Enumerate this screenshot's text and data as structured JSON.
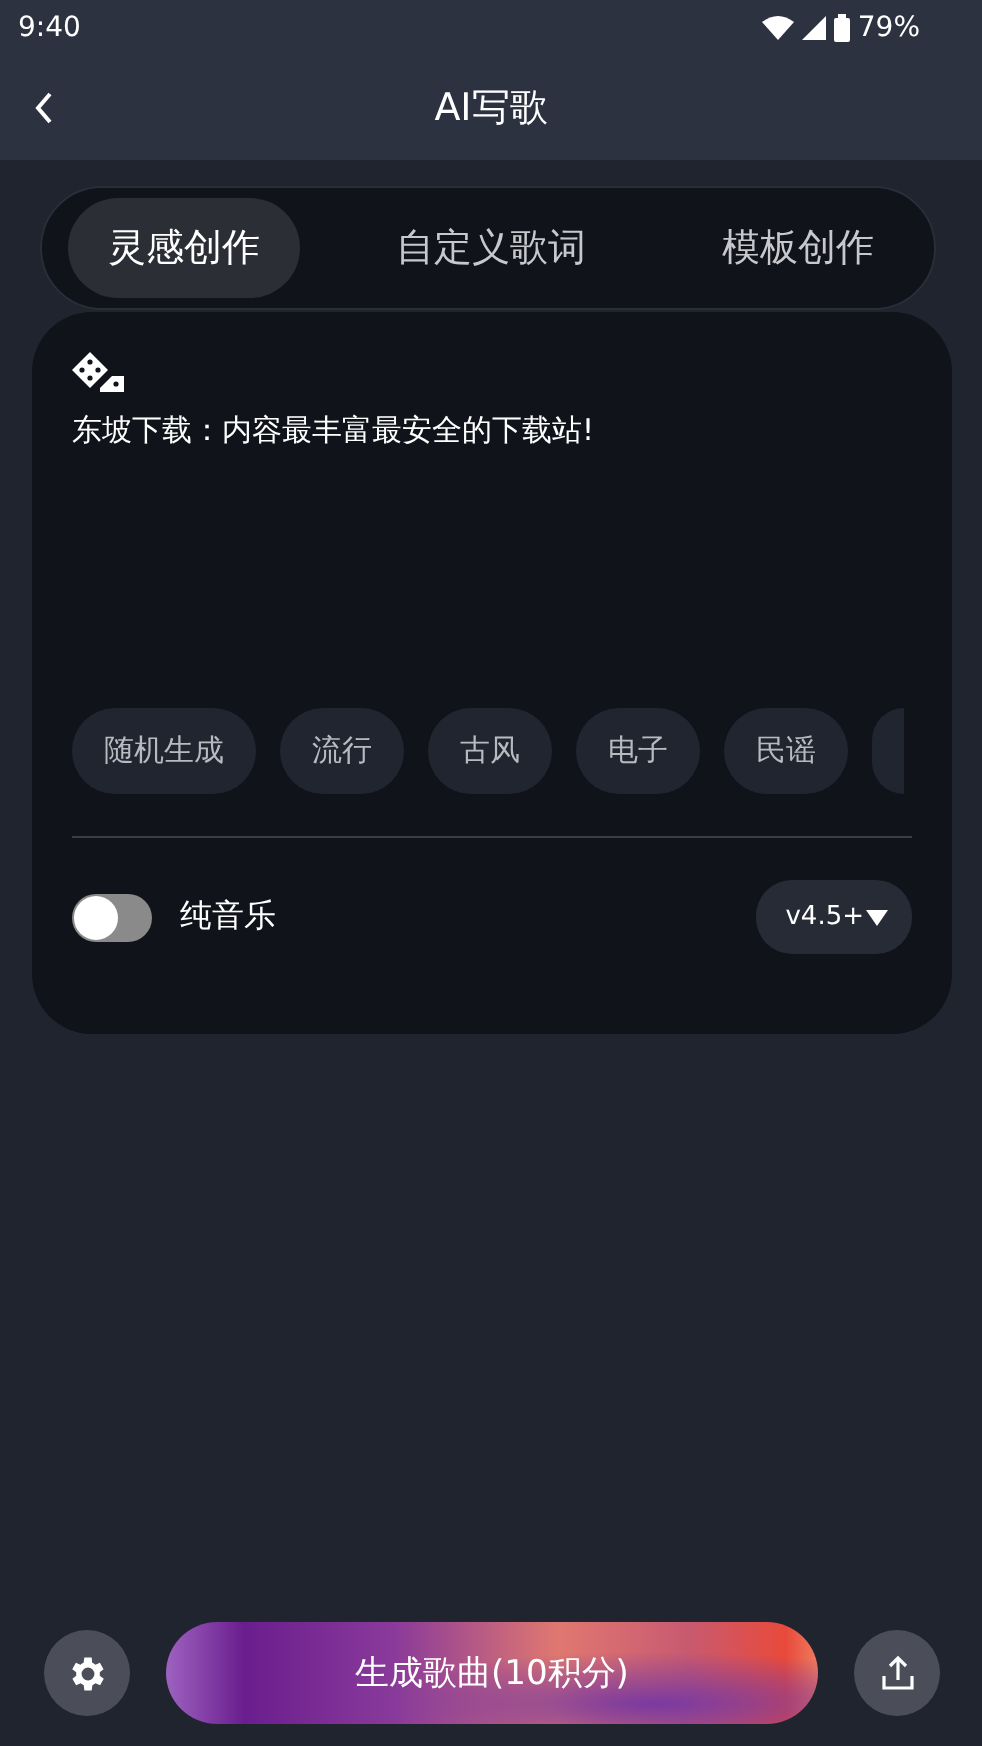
{
  "status_bar": {
    "time": "9:40",
    "battery": "79%"
  },
  "header": {
    "title": "AI写歌"
  },
  "tabs": [
    {
      "label": "灵感创作",
      "selected": true
    },
    {
      "label": "自定义歌词",
      "selected": false
    },
    {
      "label": "模板创作",
      "selected": false
    }
  ],
  "prompt": {
    "value": "东坡下载：内容最丰富最安全的下载站!"
  },
  "chips": [
    "随机生成",
    "流行",
    "古风",
    "电子",
    "民谣"
  ],
  "instrumental": {
    "label": "纯音乐",
    "on": false
  },
  "model": {
    "label": "v4.5+"
  },
  "generate_button": {
    "label": "生成歌曲(10积分)"
  }
}
